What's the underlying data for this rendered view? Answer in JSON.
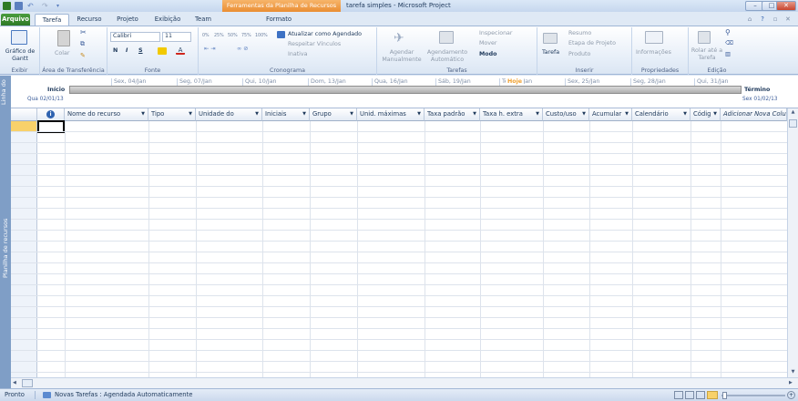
{
  "title_bar": {
    "context_tab": "Ferramentas da Planilha de Recursos",
    "window_title": "tarefa simples - Microsoft Project"
  },
  "tabs": [
    "Arquivo",
    "Tarefa",
    "Recurso",
    "Projeto",
    "Exibição",
    "Team",
    "Formato"
  ],
  "ribbon": {
    "exibir": {
      "button": "Gráfico de Gantt",
      "label": "Exibir"
    },
    "clipboard": {
      "paste": "Colar",
      "label": "Área de Transferência"
    },
    "font": {
      "family": "Calibri",
      "size": "11",
      "bold": "N",
      "italic": "I",
      "underline": "S",
      "label": "Fonte"
    },
    "cronograma": {
      "update_schedule": "Atualizar como Agendado",
      "respect_links": "Respeitar Vínculos",
      "inactive": "Inativa",
      "label": "Cronograma",
      "pct": [
        "0%",
        "25%",
        "50%",
        "75%",
        "100%"
      ]
    },
    "tarefas": {
      "manual": "Agendar Manualmente",
      "auto": "Agendamento Automático",
      "inspect": "Inspecionar",
      "move": "Mover",
      "mode": "Modo",
      "label": "Tarefas"
    },
    "inserir": {
      "task": "Tarefa",
      "summary": "Resumo",
      "milestone": "Etapa de Projeto",
      "deliverable": "Produto",
      "label": "Inserir"
    },
    "propriedades": {
      "info": "Informações",
      "label": "Propriedades"
    },
    "edicao": {
      "scroll": "Rolar até a Tarefa",
      "label": "Edição"
    }
  },
  "timeline": {
    "side_label": "Linha do",
    "start_label": "Início",
    "start_date": "Qua 02/01/13",
    "end_label": "Término",
    "end_date": "Sex 01/02/13",
    "today": "Hoje",
    "dates": [
      "Sex, 04/Jan",
      "Seg, 07/Jan",
      "Qui, 10/Jan",
      "Dom, 13/Jan",
      "Qua, 16/Jan",
      "Sáb, 19/Jan",
      "Ter, 22/Jan",
      "Sex, 25/Jan",
      "Seg, 28/Jan",
      "Qui, 31/Jan"
    ]
  },
  "sheet": {
    "side_label": "Planilha de recursos",
    "columns": [
      "Nome do recurso",
      "Tipo",
      "Unidade do",
      "Iniciais",
      "Grupo",
      "Unid. máximas",
      "Taxa padrão",
      "Taxa h. extra",
      "Custo/uso",
      "Acumular",
      "Calendário",
      "Códig",
      "Adicionar Nova Colu"
    ]
  },
  "status_bar": {
    "ready": "Pronto",
    "new_tasks": "Novas Tarefas : Agendada Automaticamente"
  }
}
